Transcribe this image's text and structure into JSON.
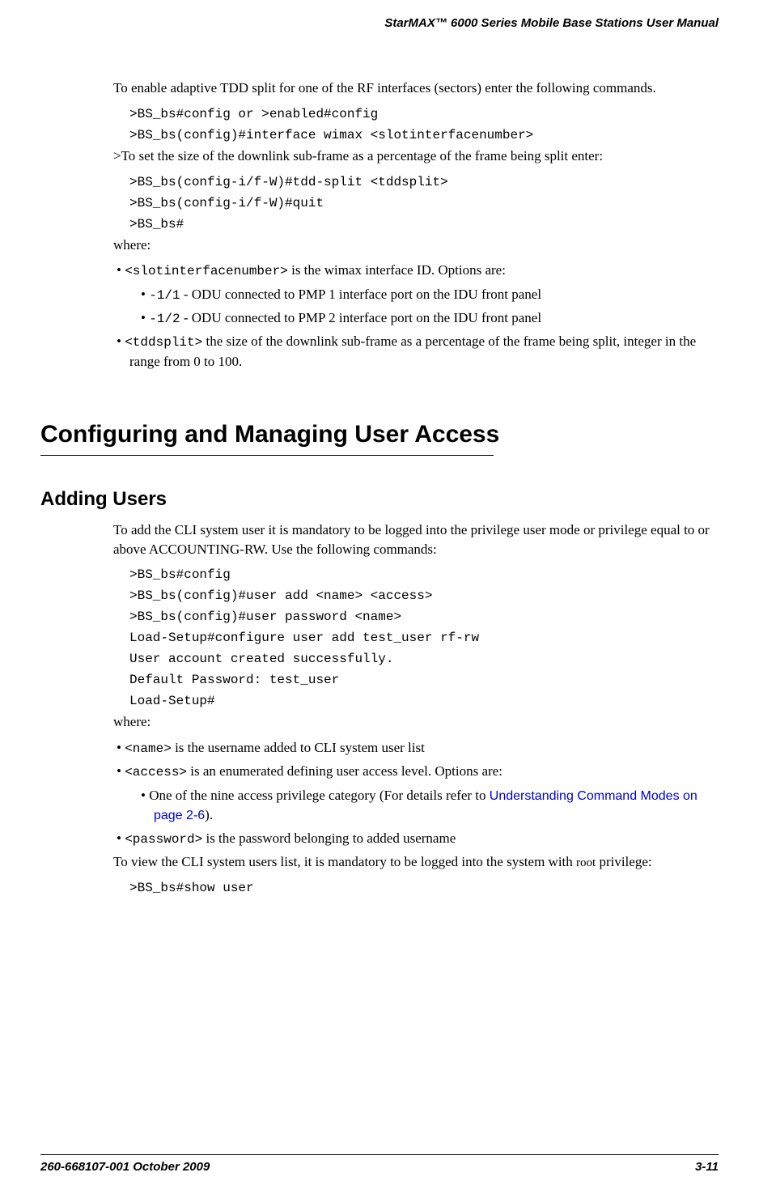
{
  "header": "StarMAX™ 6000 Series Mobile Base Stations User Manual",
  "p1": "To enable adaptive TDD split for one of the RF interfaces (sectors) enter the following commands.",
  "c1": ">BS_bs#config or >enabled#config",
  "c2": ">BS_bs(config)#interface wimax <slotinterfacenumber>",
  "p2": ">To set the size of the downlink sub-frame as a percentage of the frame being split enter:",
  "c3": ">BS_bs(config-i/f-W)#tdd-split <tddsplit>",
  "c4": ">BS_bs(config-i/f-W)#quit",
  "c5": ">BS_bs#",
  "p3": "where:",
  "b1a": "<slotinterfacenumber>",
  "b1b": " is the wimax interface ID. Options are:",
  "b1_1a": "-1/1",
  "b1_1b": " - ODU connected to PMP 1 interface port on the IDU front panel",
  "b1_2a": "-1/2",
  "b1_2b": " - ODU connected to PMP 2 interface port on the IDU front panel",
  "b2a": "<tddsplit>",
  "b2b": " the size of the downlink sub-frame as a percentage of the frame being split, integer in the range from 0 to 100.",
  "h1": "Configuring and Managing User Access",
  "h2": "Adding Users",
  "p4": "To add the CLI system user it is mandatory to be logged into the privilege user mode or privilege equal to or above ACCOUNTING-RW. Use the following commands:",
  "c6": ">BS_bs#config",
  "c7": ">BS_bs(config)#user add <name> <access>",
  "c8": ">BS_bs(config)#user password <name>",
  "c9": "Load-Setup#configure user add test_user rf-rw",
  "c10": "User account created successfully.",
  "c11": "Default Password: test_user",
  "c12": "Load-Setup#",
  "p5": "where:",
  "b3a": "<name>",
  "b3b": " is the username added to CLI system user list",
  "b4a": "<access>",
  "b4b": " is an enumerated defining user access level. Options are:",
  "b4_1a": "One of the nine access privilege category (For details refer to ",
  "b4_1link": "Understanding Command Modes on page 2-6",
  "b4_1b": ").",
  "b5a": "<password>",
  "b5b": " is the password belonging to added username",
  "p6a": "To view the CLI system users list, it is mandatory to be logged into the system with ",
  "p6root": "root",
  "p6b": " privilege:",
  "c13": ">BS_bs#show user",
  "footer_left": "260-668107-001 October 2009",
  "footer_right": "3-11"
}
